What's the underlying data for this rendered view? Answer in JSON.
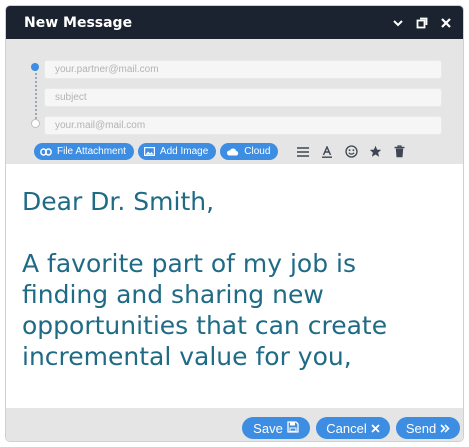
{
  "window": {
    "title": "New Message",
    "controls": [
      "chevron-down-icon",
      "restore-icon",
      "close-icon"
    ]
  },
  "fields": {
    "to_placeholder": "your.partner@mail.com",
    "subject_placeholder": "subject",
    "from_placeholder": "your.mail@mail.com"
  },
  "toolbar": {
    "attachments": [
      {
        "label": "File Attachment",
        "icon": "link-icon"
      },
      {
        "label": "Add Image",
        "icon": "image-icon"
      },
      {
        "label": "Cloud",
        "icon": "cloud-icon"
      }
    ],
    "tools": [
      "align-icon",
      "font-color-icon",
      "emoji-icon",
      "star-icon",
      "trash-icon"
    ]
  },
  "message": {
    "body": "Dear Dr. Smith,\n\nA favorite part of my job is\nfinding and sharing new\nopportunities that can create\nincremental value for you,"
  },
  "footer": {
    "save_label": "Save",
    "cancel_label": "Cancel",
    "send_label": "Send"
  },
  "colors": {
    "titlebar": "#1b2230",
    "accent": "#3d8de2",
    "text": "#1f6b86",
    "panel": "#e5e5e5"
  }
}
